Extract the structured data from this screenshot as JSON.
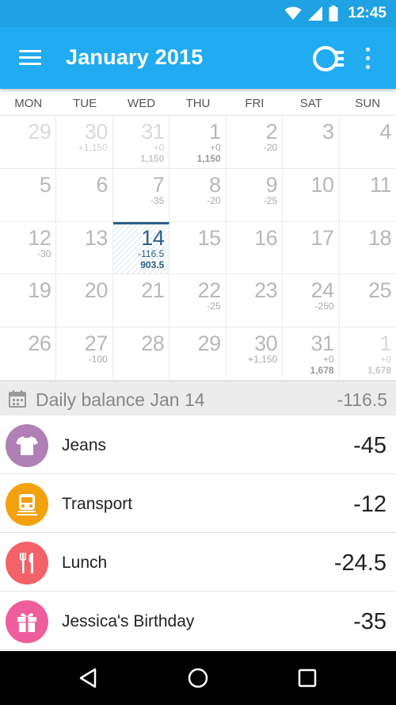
{
  "status_bar": {
    "time": "12:45",
    "icons": [
      "wifi-icon",
      "signal-icon",
      "battery-icon"
    ]
  },
  "app_bar": {
    "title": "January 2015",
    "icons": [
      "menu-icon",
      "toggle-icon",
      "overflow-menu-icon"
    ]
  },
  "colors": {
    "status_bar": "#1ea2e4",
    "app_bar": "#21acf2",
    "selected": "#2d5e8a",
    "clothes": "#b07fb5",
    "transport": "#f3a10d",
    "food": "#f36268",
    "gift": "#ef5e9c"
  },
  "weekdays": [
    "MON",
    "TUE",
    "WED",
    "THU",
    "FRI",
    "SAT",
    "SUN"
  ],
  "calendar": {
    "weeks": [
      [
        {
          "day": "29",
          "other": true,
          "amount": "",
          "balance": ""
        },
        {
          "day": "30",
          "other": true,
          "amount": "+1,150",
          "balance": ""
        },
        {
          "day": "31",
          "other": true,
          "amount": "+0",
          "balance": "1,150"
        },
        {
          "day": "1",
          "other": false,
          "amount": "+0",
          "balance": "1,150"
        },
        {
          "day": "2",
          "other": false,
          "amount": "-20",
          "balance": ""
        },
        {
          "day": "3",
          "other": false,
          "amount": "",
          "balance": ""
        },
        {
          "day": "4",
          "other": false,
          "amount": "",
          "balance": ""
        }
      ],
      [
        {
          "day": "5",
          "other": false,
          "amount": "",
          "balance": ""
        },
        {
          "day": "6",
          "other": false,
          "amount": "",
          "balance": ""
        },
        {
          "day": "7",
          "other": false,
          "amount": "-35",
          "balance": ""
        },
        {
          "day": "8",
          "other": false,
          "amount": "-20",
          "balance": ""
        },
        {
          "day": "9",
          "other": false,
          "amount": "-25",
          "balance": ""
        },
        {
          "day": "10",
          "other": false,
          "amount": "",
          "balance": ""
        },
        {
          "day": "11",
          "other": false,
          "amount": "",
          "balance": ""
        }
      ],
      [
        {
          "day": "12",
          "other": false,
          "amount": "-30",
          "balance": ""
        },
        {
          "day": "13",
          "other": false,
          "amount": "",
          "balance": ""
        },
        {
          "day": "14",
          "other": false,
          "selected": true,
          "amount": "-116.5",
          "balance": "903.5"
        },
        {
          "day": "15",
          "other": false,
          "amount": "",
          "balance": ""
        },
        {
          "day": "16",
          "other": false,
          "amount": "",
          "balance": ""
        },
        {
          "day": "17",
          "other": false,
          "amount": "",
          "balance": ""
        },
        {
          "day": "18",
          "other": false,
          "amount": "",
          "balance": ""
        }
      ],
      [
        {
          "day": "19",
          "other": false,
          "amount": "",
          "balance": ""
        },
        {
          "day": "20",
          "other": false,
          "amount": "",
          "balance": ""
        },
        {
          "day": "21",
          "other": false,
          "amount": "",
          "balance": ""
        },
        {
          "day": "22",
          "other": false,
          "amount": "-25",
          "balance": ""
        },
        {
          "day": "23",
          "other": false,
          "amount": "",
          "balance": ""
        },
        {
          "day": "24",
          "other": false,
          "amount": "-250",
          "balance": ""
        },
        {
          "day": "25",
          "other": false,
          "amount": "",
          "balance": ""
        }
      ],
      [
        {
          "day": "26",
          "other": false,
          "amount": "",
          "balance": ""
        },
        {
          "day": "27",
          "other": false,
          "amount": "-100",
          "balance": ""
        },
        {
          "day": "28",
          "other": false,
          "amount": "",
          "balance": ""
        },
        {
          "day": "29",
          "other": false,
          "amount": "",
          "balance": ""
        },
        {
          "day": "30",
          "other": false,
          "amount": "+1,150",
          "balance": ""
        },
        {
          "day": "31",
          "other": false,
          "amount": "+0",
          "balance": "1,678"
        },
        {
          "day": "1",
          "other": true,
          "amount": "+0",
          "balance": "1,678"
        }
      ]
    ]
  },
  "daily_balance": {
    "label": "Daily balance Jan 14",
    "total": "-116.5",
    "icon": "calendar-icon"
  },
  "transactions": [
    {
      "name": "Jeans",
      "amount": "-45",
      "icon": "tshirt-icon",
      "color": "#b07fb5"
    },
    {
      "name": "Transport",
      "amount": "-12",
      "icon": "train-icon",
      "color": "#f3a10d"
    },
    {
      "name": "Lunch",
      "amount": "-24.5",
      "icon": "fork-knife-icon",
      "color": "#f36268"
    },
    {
      "name": "Jessica's Birthday",
      "amount": "-35",
      "icon": "gift-icon",
      "color": "#ef5e9c"
    }
  ],
  "nav_bar": {
    "icons": [
      "back-icon",
      "home-icon",
      "recents-icon"
    ]
  }
}
